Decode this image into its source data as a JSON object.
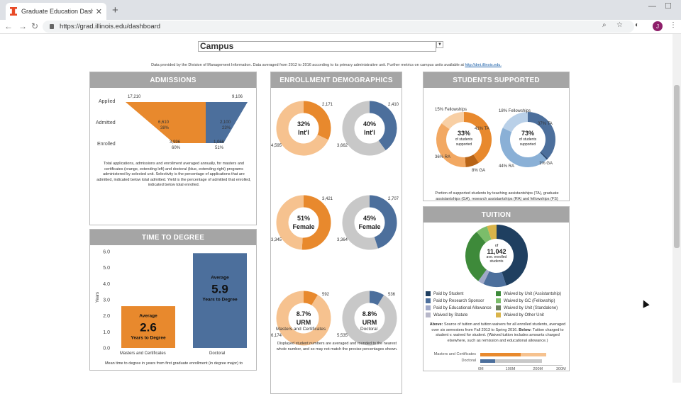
{
  "browser": {
    "tab_title": "Graduate Education Dashboard |",
    "url": "https://grad.illinois.edu/dashboard",
    "avatar_letter": "J"
  },
  "selector": {
    "value": "Campus"
  },
  "source_note": {
    "text": "Data provided by the Division of Management Information. Data averaged from 2012 to 2016 according to its primary administrative unit. Further metrics on campus units available at",
    "link": "http://dmi.illinois.edu."
  },
  "admissions": {
    "title": "ADMISSIONS",
    "rows": [
      "Applied",
      "Admitted",
      "Enrolled"
    ],
    "masters": {
      "applied": "17,210",
      "admitted": "6,610",
      "admitted_pct": "38%",
      "enrolled": "3,996",
      "enrolled_pct": "60%"
    },
    "doctoral": {
      "applied": "9,106",
      "admitted": "2,100",
      "admitted_pct": "23%",
      "enrolled": "1,066",
      "enrolled_pct": "51%"
    },
    "note": "Total applications, admissions and enrollment averaged annually, for masters and certificates (orange, extending left) and doctoral (blue, extending right) programs administered by selected unit. Selectivity is the percentage of applications that are admitted, indicated below total admitted. Yield is the percentage of admitted that enrolled, indicated below total enrolled."
  },
  "time_to_degree": {
    "title": "TIME TO DEGREE",
    "ylabel": "Years",
    "ticks": [
      "6.0",
      "5.0",
      "4.0",
      "3.0",
      "2.0",
      "1.0",
      "0.0"
    ],
    "bars": [
      {
        "label": "Masters and Certificates",
        "value": 2.6,
        "display": "2.6",
        "caption_top": "Average",
        "caption_bottom": "Years to Degree",
        "color": "#e8892d"
      },
      {
        "label": "Doctoral",
        "value": 5.9,
        "display": "5.9",
        "caption_top": "Average",
        "caption_bottom": "Years to Degree",
        "color": "#4c6f9c"
      }
    ],
    "note": "Mean time to degree in years from first graduate enrollment (in degree major) to completion."
  },
  "enrollment": {
    "title": "ENROLLMENT DEMOGRAPHICS",
    "masters_label": "Masters and Certificates",
    "doctoral_label": "Doctoral",
    "donuts": [
      {
        "pct": "32%",
        "label": "Int'l",
        "a": "2,171",
        "b": "4,595",
        "frac": 0.32,
        "color": "#e8892d",
        "rest": "#f6c28f"
      },
      {
        "pct": "40%",
        "label": "Int'l",
        "a": "2,410",
        "b": "3,662",
        "frac": 0.4,
        "color": "#4c6f9c",
        "rest": "#c8c8c8"
      },
      {
        "pct": "51%",
        "label": "Female",
        "a": "3,421",
        "b": "3,345",
        "frac": 0.51,
        "color": "#e8892d",
        "rest": "#f6c28f"
      },
      {
        "pct": "45%",
        "label": "Female",
        "a": "2,707",
        "b": "3,364",
        "frac": 0.45,
        "color": "#4c6f9c",
        "rest": "#c8c8c8"
      },
      {
        "pct": "8.7%",
        "label": "URM",
        "a": "592",
        "b": "6,174",
        "frac": 0.087,
        "color": "#e8892d",
        "rest": "#f6c28f"
      },
      {
        "pct": "8.8%",
        "label": "URM",
        "a": "536",
        "b": "5,535",
        "frac": 0.088,
        "color": "#4c6f9c",
        "rest": "#c8c8c8"
      }
    ],
    "note": "Displayed student numbers are averaged and rounded to the nearest whole number, and so may not match the precise percentages shown."
  },
  "supported": {
    "title": "STUDENTS SUPPORTED",
    "masters": {
      "pct": "33%",
      "sub1": "of students",
      "sub2": "supported",
      "fellow": "15% Fellowships",
      "ta": "41% TA",
      "ra": "36% RA",
      "ga": "8% GA",
      "segments": [
        0.41,
        0.08,
        0.36,
        0.15
      ],
      "colors": [
        "#e8892d",
        "#b86417",
        "#f2a862",
        "#f8cfa4"
      ]
    },
    "doctoral": {
      "pct": "73%",
      "sub1": "of students",
      "sub2": "supported",
      "fellow": "18% Fellowships",
      "ta": "37% TA",
      "ra": "44% RA",
      "ga": "1% GA",
      "segments": [
        0.37,
        0.01,
        0.44,
        0.18
      ],
      "colors": [
        "#4c6f9c",
        "#2b4a73",
        "#8ab0d6",
        "#b9d0e8"
      ]
    },
    "note": "Portion of supported students by teaching assistantships (TA), graduate assistantships (GA), research assistantships (RA) and fellowships (FS)"
  },
  "tuition": {
    "title": "TUITION",
    "center_top": "of",
    "center_value": "11,042",
    "center_sub1": "ave. enrolled",
    "center_sub2": "students",
    "segments": [
      {
        "frac": 0.45,
        "color": "#1f3f60"
      },
      {
        "frac": 0.12,
        "color": "#4c6f9c"
      },
      {
        "frac": 0.03,
        "color": "#9fa8c8"
      },
      {
        "frac": 0.29,
        "color": "#3e8a3a"
      },
      {
        "frac": 0.06,
        "color": "#7bbd6a"
      },
      {
        "frac": 0.05,
        "color": "#d9b44a"
      }
    ],
    "legend_left": [
      {
        "label": "Paid by Student",
        "color": "#1f3f60"
      },
      {
        "label": "Paid by Research Sponsor",
        "color": "#4c6f9c"
      },
      {
        "label": "Paid by Educational Allowance",
        "color": "#9fa8c8"
      },
      {
        "label": "Waived by Statute",
        "color": "#b7b7c9"
      }
    ],
    "legend_right": [
      {
        "label": "Waived by Unit (Assistantship)",
        "color": "#3e8a3a"
      },
      {
        "label": "Waived by GC (Fellowship)",
        "color": "#7bbd6a"
      },
      {
        "label": "Waived by Unit (Standalone)",
        "color": "#6b7f5e"
      },
      {
        "label": "Waived by Other Unit",
        "color": "#d9b44a"
      }
    ],
    "note_above": "Above:",
    "note": "Source of tuition and tuition waivers for all enrolled students, averaged over six semesters from Fall 2013 to Spring 2016.",
    "note_below": "Below:",
    "note2": "Tuition charged to student v. waived for student. (Waived tuition includes amounts charged elsewhere, such as remission and educational allowance.)",
    "bar_rows": [
      {
        "label": "Masters and Certificates",
        "charged": 0.49,
        "waived": 0.31,
        "c1": "#e8892d",
        "c2": "#f6c28f"
      },
      {
        "label": "Doctoral",
        "charged": 0.18,
        "waived": 0.57,
        "c1": "#4c6f9c",
        "c2": "#c8c8c8"
      }
    ],
    "axis": [
      "0M",
      "100M",
      "200M",
      "300M"
    ]
  }
}
